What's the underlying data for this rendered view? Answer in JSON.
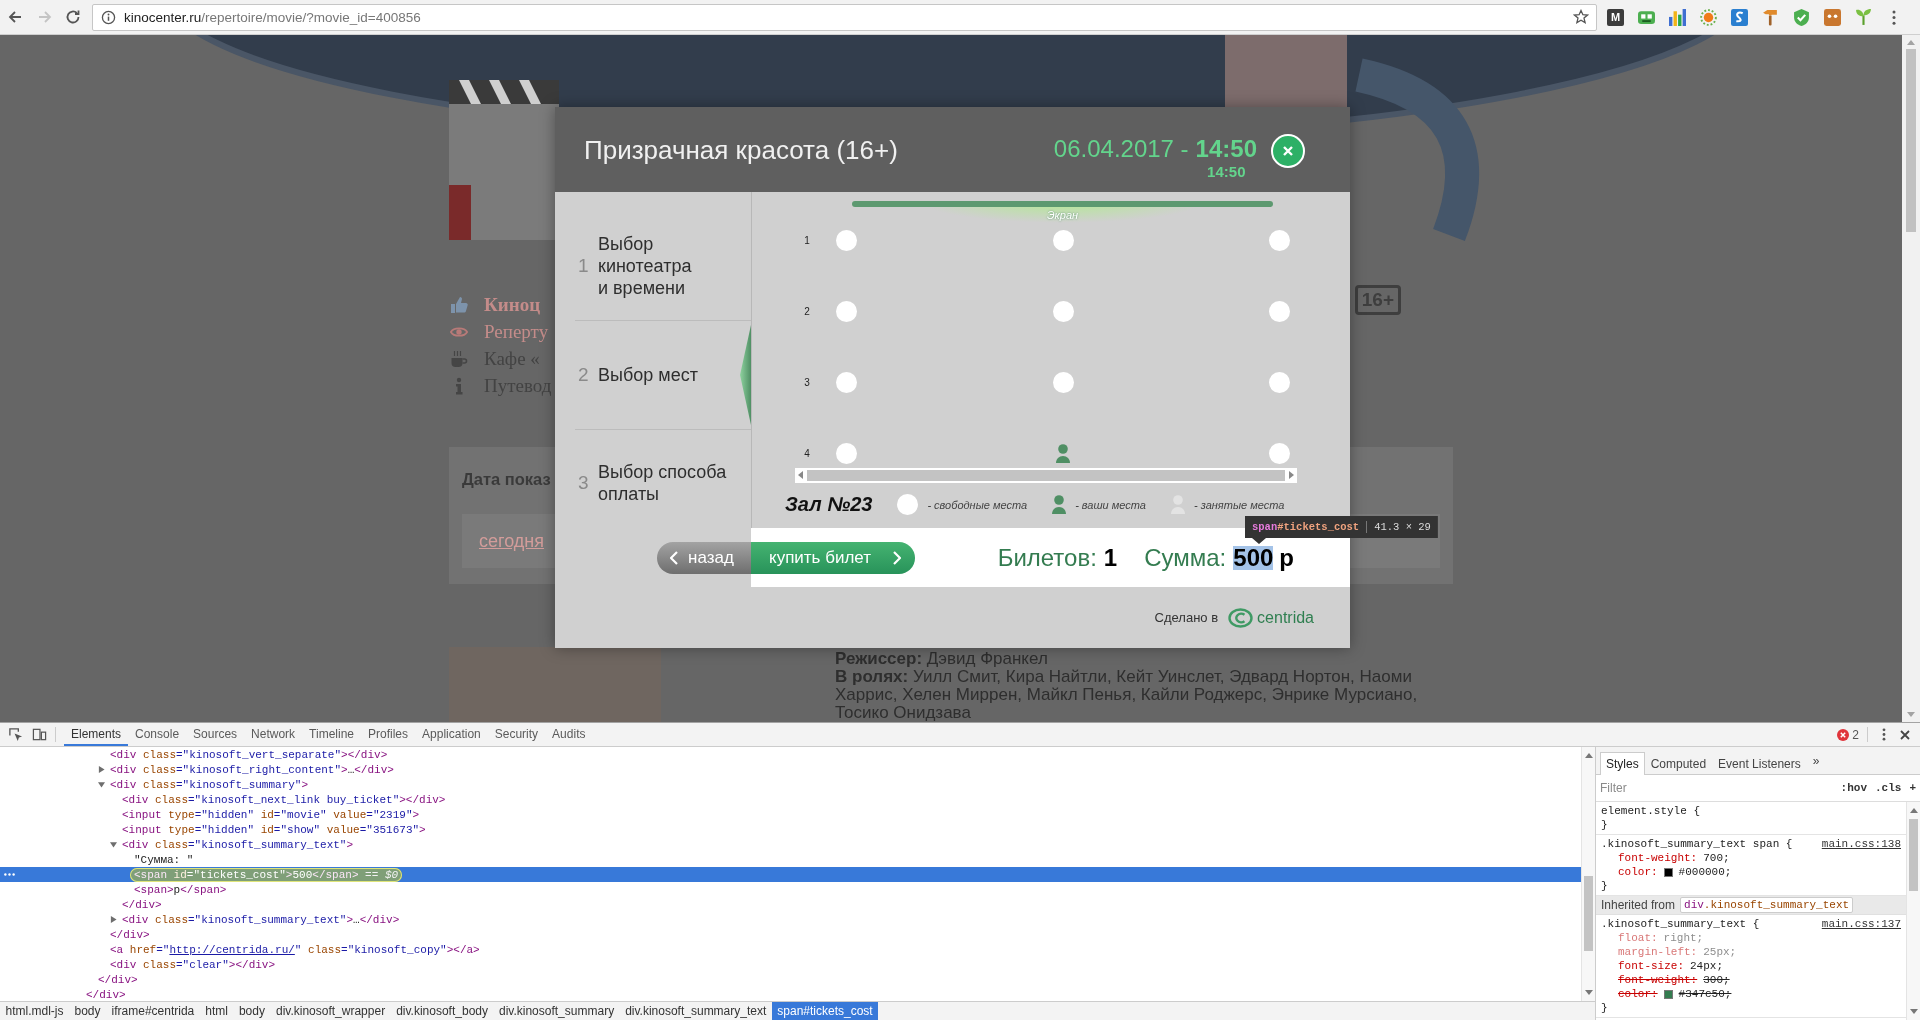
{
  "browser": {
    "back": {
      "disabled": false
    },
    "forward": {
      "disabled": true
    },
    "url_host": "kinocenter.ru",
    "url_path": "/repertoire/movie/?movie_id=400856",
    "extension_label": "M"
  },
  "page": {
    "nav": [
      {
        "kind": "cinema",
        "label": "Киноц",
        "color": "#c48c8a"
      },
      {
        "kind": "repertoire",
        "label": "Реперту",
        "color": "#c48c8a"
      },
      {
        "kind": "cafe",
        "label": "Кафе «",
        "color": "#434343"
      },
      {
        "kind": "guide",
        "label": "Путевод",
        "color": "#434343"
      }
    ],
    "age_badge": "16+",
    "date_box": {
      "title": "Дата показ",
      "link": "сегодня"
    },
    "credits": [
      "**Режиссер:** Дэвид Франкел",
      "**В ролях:** Уилл Смит, Кира Найтли, Кейт Уинслет, Эдвард Нортон, Наоми Харрис, Хелен Миррен, Майкл Пенья, Кайли Роджерс, Энрике Мурсиано, Тосико Онидзава"
    ]
  },
  "modal": {
    "title": "Призрачная красота (16+)",
    "date": "06.04.2017 -",
    "time": "14:50",
    "time_note": "14:50",
    "steps": [
      {
        "number": "1",
        "label": "Выбор\nкинотеатра\nи времени",
        "selected": false
      },
      {
        "number": "2",
        "label": "Выбор мест",
        "selected": true
      },
      {
        "number": "3",
        "label": "Выбор способа\nоплаты",
        "selected": false
      }
    ],
    "screen_label": "Экран",
    "seat_rows": [
      {
        "label": "1",
        "seats": [
          {
            "kind": "free"
          },
          {
            "kind": "free"
          },
          {
            "kind": "free"
          }
        ]
      },
      {
        "label": "2",
        "seats": [
          {
            "kind": "free"
          },
          {
            "kind": "free"
          },
          {
            "kind": "free"
          }
        ]
      },
      {
        "label": "3",
        "seats": [
          {
            "kind": "free"
          },
          {
            "kind": "free"
          },
          {
            "kind": "free"
          }
        ]
      },
      {
        "label": "4",
        "seats": [
          {
            "kind": "free"
          },
          {
            "kind": "mine"
          },
          {
            "kind": "free"
          }
        ]
      }
    ],
    "hall": "Зал №23",
    "legend": [
      {
        "kind": "free",
        "label": "- свободные места"
      },
      {
        "kind": "mine",
        "label": "- ваши места"
      },
      {
        "kind": "taken",
        "label": "- занятые места"
      }
    ],
    "back_button": "назад",
    "buy_button": "купить билет",
    "tickets": {
      "label": "Билетов:",
      "value": "1"
    },
    "total": {
      "label": "Сумма:",
      "value": "500",
      "unit": "р",
      "inspected": true
    },
    "credit": {
      "label": "Сделано в",
      "brand": "centrida"
    }
  },
  "inspect_tooltip": {
    "tag": "span",
    "id": "#tickets_cost",
    "size": "41.3 × 29"
  },
  "devtools": {
    "tabs": [
      {
        "label": "Elements",
        "selected": true
      },
      {
        "label": "Console",
        "selected": false
      },
      {
        "label": "Sources",
        "selected": false
      },
      {
        "label": "Network",
        "selected": false
      },
      {
        "label": "Timeline",
        "selected": false
      },
      {
        "label": "Profiles",
        "selected": false
      },
      {
        "label": "Application",
        "selected": false
      },
      {
        "label": "Security",
        "selected": false
      },
      {
        "label": "Audits",
        "selected": false
      }
    ],
    "error_count": "2",
    "dom_tree": [
      {
        "close": "</div>",
        "children": [
          {
            "close": "</div>",
            "children": [
              {
                "tokens": [
                  {
                    "kind": "tag",
                    "text": "<div"
                  },
                  {
                    "kind": "attr",
                    "text": " class"
                  },
                  {
                    "kind": "value",
                    "text": "=\"kinosoft_vert_separate\""
                  },
                  {
                    "kind": "tag",
                    "text": "></div>"
                  }
                ],
                "selected": false
              },
              {
                "tokens": [
                  {
                    "kind": "tag",
                    "text": "<div"
                  },
                  {
                    "kind": "attr",
                    "text": " class"
                  },
                  {
                    "kind": "value",
                    "text": "=\"kinosoft_right_content\""
                  },
                  {
                    "kind": "tag",
                    "text": ">"
                  },
                  {
                    "kind": "text",
                    "text": "…"
                  },
                  {
                    "kind": "tag",
                    "text": "</div>"
                  }
                ],
                "selected": false,
                "expanded": false
              },
              {
                "tokens": [
                  {
                    "kind": "tag",
                    "text": "<div"
                  },
                  {
                    "kind": "attr",
                    "text": " class"
                  },
                  {
                    "kind": "value",
                    "text": "=\"kinosoft_summary\""
                  },
                  {
                    "kind": "tag",
                    "text": ">"
                  }
                ],
                "selected": false,
                "expanded": true,
                "close": "</div>",
                "children": [
                  {
                    "tokens": [
                      {
                        "kind": "tag",
                        "text": "<div"
                      },
                      {
                        "kind": "attr",
                        "text": " class"
                      },
                      {
                        "kind": "value",
                        "text": "=\"kinosoft_next_link buy_ticket\""
                      },
                      {
                        "kind": "tag",
                        "text": "></div>"
                      }
                    ],
                    "selected": false
                  },
                  {
                    "tokens": [
                      {
                        "kind": "tag",
                        "text": "<input"
                      },
                      {
                        "kind": "attr",
                        "text": " type"
                      },
                      {
                        "kind": "value",
                        "text": "=\"hidden\""
                      },
                      {
                        "kind": "attr",
                        "text": " id"
                      },
                      {
                        "kind": "value",
                        "text": "=\"movie\""
                      },
                      {
                        "kind": "attr",
                        "text": " value"
                      },
                      {
                        "kind": "value",
                        "text": "=\"2319\""
                      },
                      {
                        "kind": "tag",
                        "text": ">"
                      }
                    ],
                    "selected": false
                  },
                  {
                    "tokens": [
                      {
                        "kind": "tag",
                        "text": "<input"
                      },
                      {
                        "kind": "attr",
                        "text": " type"
                      },
                      {
                        "kind": "value",
                        "text": "=\"hidden\""
                      },
                      {
                        "kind": "attr",
                        "text": " id"
                      },
                      {
                        "kind": "value",
                        "text": "=\"show\""
                      },
                      {
                        "kind": "attr",
                        "text": " value"
                      },
                      {
                        "kind": "value",
                        "text": "=\"351673\""
                      },
                      {
                        "kind": "tag",
                        "text": ">"
                      }
                    ],
                    "selected": false
                  },
                  {
                    "tokens": [
                      {
                        "kind": "tag",
                        "text": "<div"
                      },
                      {
                        "kind": "attr",
                        "text": " class"
                      },
                      {
                        "kind": "value",
                        "text": "=\"kinosoft_summary_text\""
                      },
                      {
                        "kind": "tag",
                        "text": ">"
                      }
                    ],
                    "selected": false,
                    "expanded": true,
                    "close": "</div>",
                    "children": [
                      {
                        "tokens": [
                          {
                            "kind": "text",
                            "text": "\"Сумма: \""
                          }
                        ],
                        "selected": false
                      },
                      {
                        "tokens": [
                          {
                            "kind": "tag",
                            "text": "<span"
                          },
                          {
                            "kind": "attr",
                            "text": " id"
                          },
                          {
                            "kind": "value",
                            "text": "=\"tickets_cost\""
                          },
                          {
                            "kind": "tag",
                            "text": ">"
                          },
                          {
                            "kind": "text",
                            "text": "500"
                          },
                          {
                            "kind": "tag",
                            "text": "</span>"
                          },
                          {
                            "kind": "note",
                            "text": " == $0"
                          }
                        ],
                        "selected": true
                      },
                      {
                        "tokens": [
                          {
                            "kind": "tag",
                            "text": "<span>"
                          },
                          {
                            "kind": "text",
                            "text": "р"
                          },
                          {
                            "kind": "tag",
                            "text": "</span>"
                          }
                        ],
                        "selected": false
                      }
                    ]
                  },
                  {
                    "tokens": [
                      {
                        "kind": "tag",
                        "text": "<div"
                      },
                      {
                        "kind": "attr",
                        "text": " class"
                      },
                      {
                        "kind": "value",
                        "text": "=\"kinosoft_summary_text\""
                      },
                      {
                        "kind": "tag",
                        "text": ">"
                      },
                      {
                        "kind": "text",
                        "text": "…"
                      },
                      {
                        "kind": "tag",
                        "text": "</div>"
                      }
                    ],
                    "selected": false,
                    "expanded": false
                  }
                ]
              },
              {
                "tokens": [
                  {
                    "kind": "tag",
                    "text": "<a"
                  },
                  {
                    "kind": "attr",
                    "text": " href"
                  },
                  {
                    "kind": "value",
                    "text": "=\""
                  },
                  {
                    "kind": "link",
                    "text": "http://centrida.ru/"
                  },
                  {
                    "kind": "value",
                    "text": "\""
                  },
                  {
                    "kind": "attr",
                    "text": " class"
                  },
                  {
                    "kind": "value",
                    "text": "=\"kinosoft_copy\""
                  },
                  {
                    "kind": "tag",
                    "text": "></a>"
                  }
                ],
                "selected": false
              },
              {
                "tokens": [
                  {
                    "kind": "tag",
                    "text": "<div"
                  },
                  {
                    "kind": "attr",
                    "text": " class"
                  },
                  {
                    "kind": "value",
                    "text": "=\"clear\""
                  },
                  {
                    "kind": "tag",
                    "text": "></div>"
                  }
                ],
                "selected": false
              }
            ]
          }
        ]
      }
    ],
    "breadcrumbs": [
      {
        "label": "html.mdl-js",
        "selected": false
      },
      {
        "label": "body",
        "selected": false
      },
      {
        "label": "iframe#centrida",
        "selected": false
      },
      {
        "label": "html",
        "selected": false
      },
      {
        "label": "body",
        "selected": false
      },
      {
        "label": "div.kinosoft_wrapper",
        "selected": false
      },
      {
        "label": "div.kinosoft_body",
        "selected": false
      },
      {
        "label": "div.kinosoft_summary",
        "selected": false
      },
      {
        "label": "div.kinosoft_summary_text",
        "selected": false
      },
      {
        "label": "span#tickets_cost",
        "selected": true
      }
    ],
    "styles": {
      "tabs": [
        {
          "label": "Styles",
          "selected": true
        },
        {
          "label": "Computed",
          "selected": false
        },
        {
          "label": "Event Listeners",
          "selected": false
        }
      ],
      "more": "»",
      "filter_placeholder": "Filter",
      "actions": [
        ":hov",
        ".cls",
        "+"
      ],
      "sections": [
        {
          "kind": "rule",
          "selector": "element.style {",
          "close": "}"
        },
        {
          "kind": "rule",
          "selector": ".kinosoft_summary_text span {",
          "source": "main.css:138",
          "properties": [
            {
              "name": "font-weight:",
              "value": "700;",
              "inactive": false,
              "overridden": false
            },
            {
              "name": "color:",
              "value": "#000000;",
              "color": "#000000",
              "inactive": false,
              "overridden": false
            }
          ],
          "close": "}"
        },
        {
          "kind": "inherited",
          "label": "Inherited from",
          "tag": "div",
          "class_name": ".kinosoft_summary_text"
        },
        {
          "kind": "rule",
          "selector": ".kinosoft_summary_text {",
          "source": "main.css:137",
          "properties": [
            {
              "name": "float:",
              "value": "right;",
              "inactive": true,
              "overridden": false
            },
            {
              "name": "margin-left:",
              "value": "25px;",
              "inactive": true,
              "overridden": false
            },
            {
              "name": "font-size:",
              "value": "24px;",
              "inactive": false,
              "overridden": false
            },
            {
              "name": "font-weight:",
              "value": "300;",
              "inactive": false,
              "overridden": true
            },
            {
              "name": "color:",
              "value": "#347c50;",
              "color": "#347c50",
              "inactive": false,
              "overridden": true
            }
          ],
          "close": "}"
        }
      ]
    }
  }
}
